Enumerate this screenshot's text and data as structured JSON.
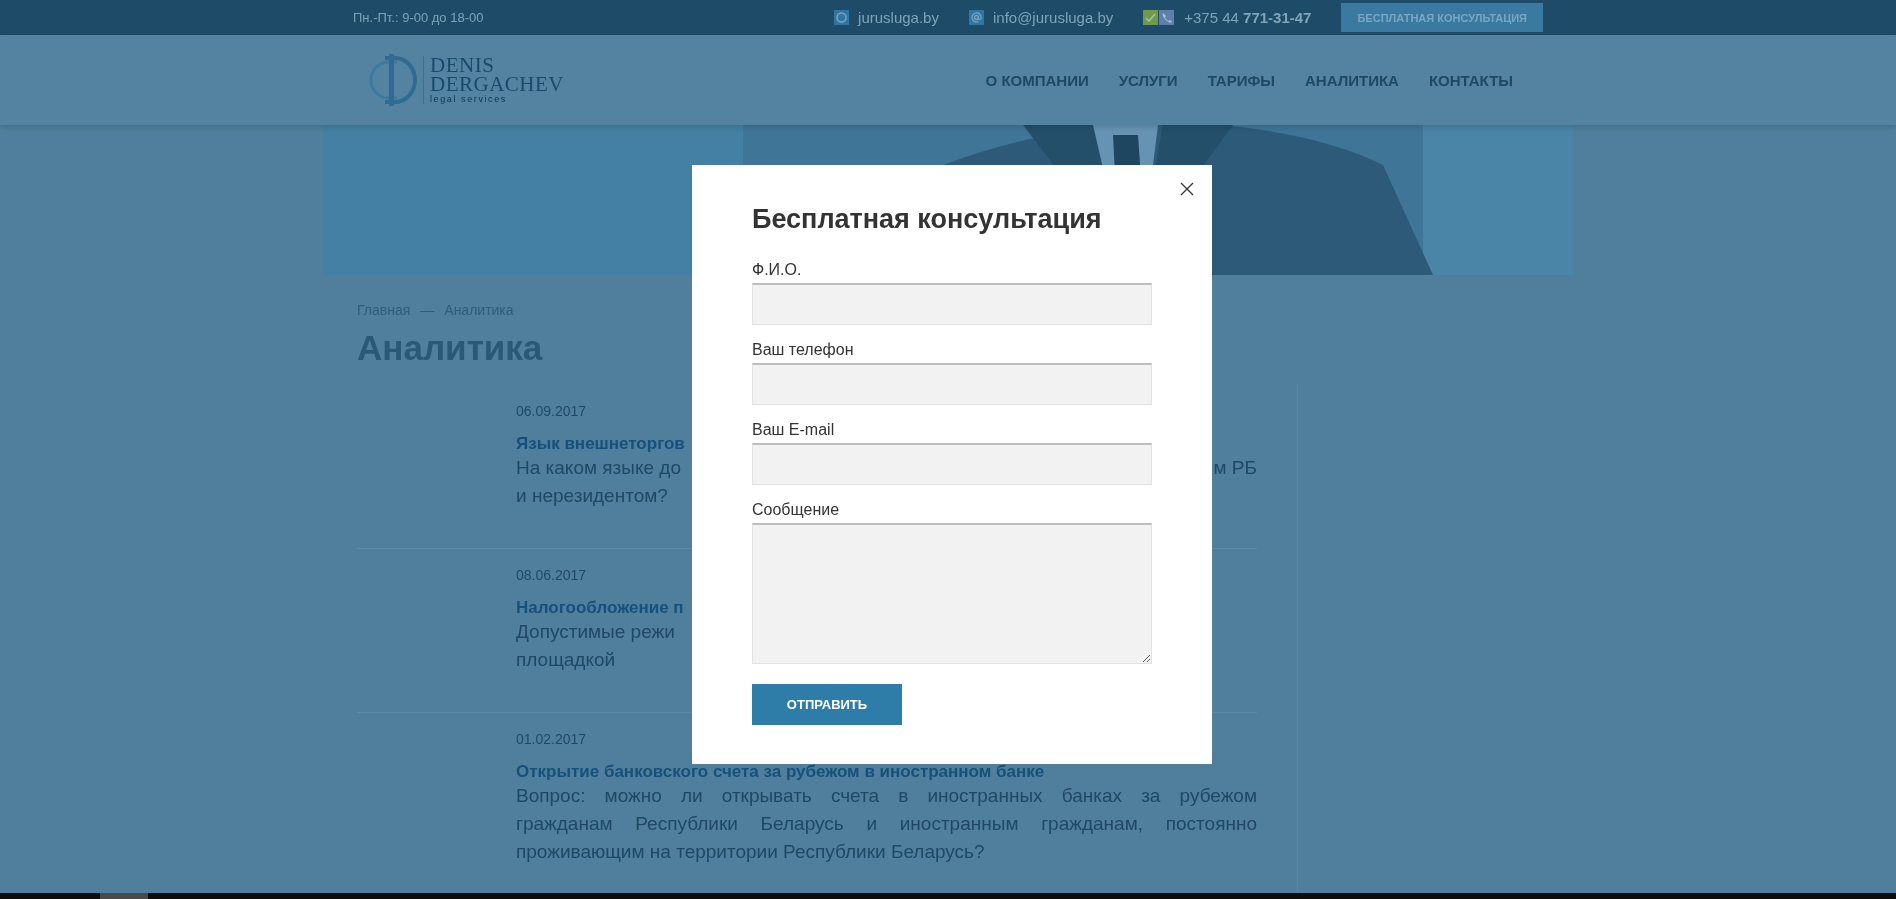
{
  "top_bar": {
    "hours": "Пн.-Пт.: 9-00 до 18-00",
    "skype": "jurusluga.by",
    "email": "info@jurusluga.by",
    "phone_prefix": "+375 44",
    "phone_number": "771-31-47",
    "cta_button": "БЕСПЛАТНАЯ КОНСУЛЬТАЦИЯ"
  },
  "logo": {
    "line1": "DENIS",
    "line2": "DERGACHEV",
    "tagline": "legal services"
  },
  "nav": [
    "О КОМПАНИИ",
    "УСЛУГИ",
    "ТАРИФЫ",
    "АНАЛИТИКА",
    "КОНТАКТЫ"
  ],
  "breadcrumb": {
    "items": [
      "Главная",
      "Аналитика"
    ],
    "separator": "—"
  },
  "page_title": "Аналитика",
  "articles": [
    {
      "date": "06.09.2017",
      "title": "Язык внешнеторгов",
      "excerpt_lines": [
        {
          "left": "На каком языке до",
          "right": "м РБ"
        },
        {
          "left": "и нерезидентом?"
        }
      ]
    },
    {
      "date": "08.06.2017",
      "title": "Налогообложение п",
      "excerpt_lines": [
        {
          "left": "Допустимые режи"
        },
        {
          "left": "площадкой"
        }
      ]
    },
    {
      "date": "01.02.2017",
      "justified": true,
      "title": "Открытие банковского счета за рубежом в иностранном банке",
      "excerpt_lines": [
        {
          "left": "Вопрос: можно ли открывать счета в иностранных банках за рубежом"
        },
        {
          "left": "гражданам Республики Беларусь и иностранным гражданам, постоянно"
        },
        {
          "left": "проживающим на территории Республики Беларусь?"
        }
      ]
    }
  ],
  "modal": {
    "title": "Бесплатная консультация",
    "fields": [
      {
        "label": "Ф.И.О.",
        "kind": "input"
      },
      {
        "label": "Ваш телефон",
        "kind": "input"
      },
      {
        "label": "Ваш E-mail",
        "kind": "input"
      },
      {
        "label": "Сообщение",
        "kind": "textarea"
      }
    ],
    "submit": "ОТПРАВИТЬ"
  }
}
